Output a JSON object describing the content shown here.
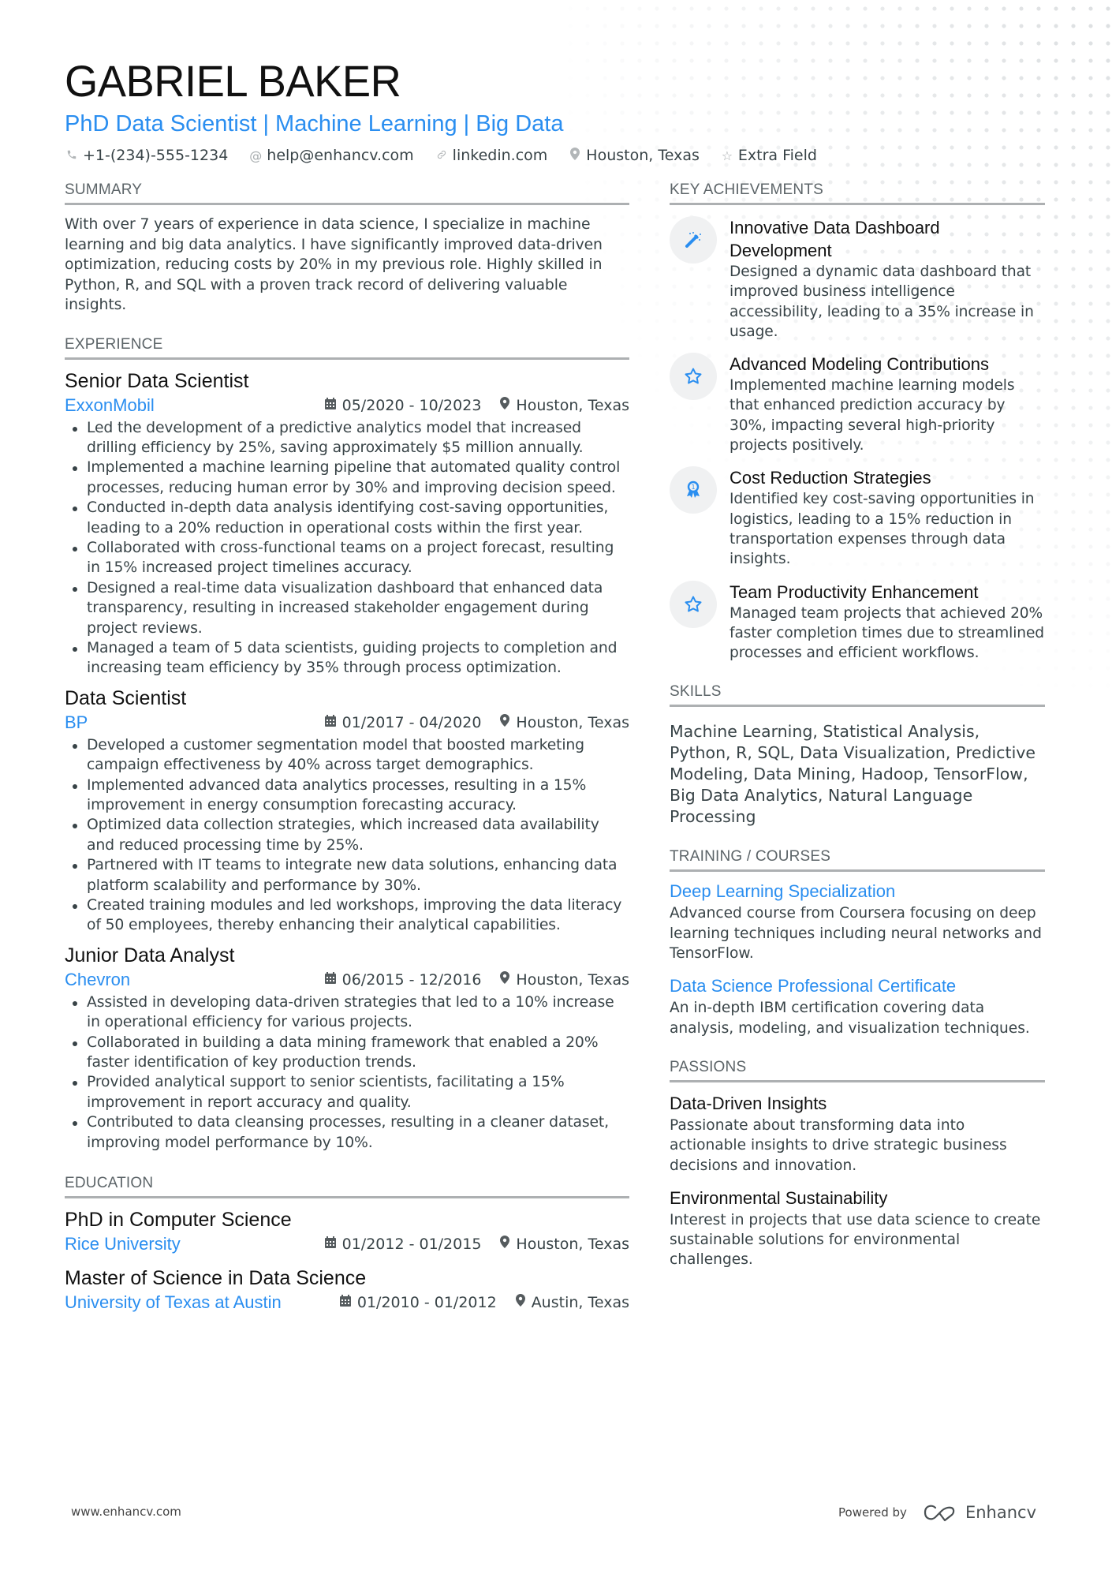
{
  "header": {
    "name": "GABRIEL BAKER",
    "headline": "PhD Data Scientist | Machine Learning | Big Data",
    "contacts": [
      {
        "icon": "phone-icon",
        "text": "+1-(234)-555-1234"
      },
      {
        "icon": "at-icon",
        "text": "help@enhancv.com"
      },
      {
        "icon": "link-icon",
        "text": "linkedin.com"
      },
      {
        "icon": "location-pin-icon",
        "text": "Houston, Texas"
      },
      {
        "icon": "star-outline-icon",
        "text": "Extra Field"
      }
    ]
  },
  "summary": {
    "title": "SUMMARY",
    "text": "With over 7 years of experience in data science, I specialize in machine learning and big data analytics. I have significantly improved data-driven optimization, reducing costs by 20% in my previous role. Highly skilled in Python, R, and SQL with a proven track record of delivering valuable insights."
  },
  "experience": {
    "title": "EXPERIENCE",
    "items": [
      {
        "role": "Senior Data Scientist",
        "company": "ExxonMobil",
        "dates": "05/2020 - 10/2023",
        "location": "Houston, Texas",
        "bullets": [
          "Led the development of a predictive analytics model that increased drilling efficiency by 25%, saving approximately $5 million annually.",
          "Implemented a machine learning pipeline that automated quality control processes, reducing human error by 30% and improving decision speed.",
          "Conducted in-depth data analysis identifying cost-saving opportunities, leading to a 20% reduction in operational costs within the first year.",
          "Collaborated with cross-functional teams on a project forecast, resulting in 15% increased project timelines accuracy.",
          "Designed a real-time data visualization dashboard that enhanced data transparency, resulting in increased stakeholder engagement during project reviews.",
          "Managed a team of 5 data scientists, guiding projects to completion and increasing team efficiency by 35% through process optimization."
        ]
      },
      {
        "role": "Data Scientist",
        "company": "BP",
        "dates": "01/2017 - 04/2020",
        "location": "Houston, Texas",
        "bullets": [
          "Developed a customer segmentation model that boosted marketing campaign effectiveness by 40% across target demographics.",
          "Implemented advanced data analytics processes, resulting in a 15% improvement in energy consumption forecasting accuracy.",
          "Optimized data collection strategies, which increased data availability and reduced processing time by 25%.",
          "Partnered with IT teams to integrate new data solutions, enhancing data platform scalability and performance by 30%.",
          "Created training modules and led workshops, improving the data literacy of 50 employees, thereby enhancing their analytical capabilities."
        ]
      },
      {
        "role": "Junior Data Analyst",
        "company": "Chevron",
        "dates": "06/2015 - 12/2016",
        "location": "Houston, Texas",
        "bullets": [
          "Assisted in developing data-driven strategies that led to a 10% increase in operational efficiency for various projects.",
          "Collaborated in building a data mining framework that enabled a 20% faster identification of key production trends.",
          "Provided analytical support to senior scientists, facilitating a 15% improvement in report accuracy and quality.",
          "Contributed to data cleansing processes, resulting in a cleaner dataset, improving model performance by 10%."
        ]
      }
    ]
  },
  "education": {
    "title": "EDUCATION",
    "items": [
      {
        "degree": "PhD in Computer Science",
        "school": "Rice University",
        "dates": "01/2012 - 01/2015",
        "location": "Houston, Texas"
      },
      {
        "degree": "Master of Science in Data Science",
        "school": "University of Texas at Austin",
        "dates": "01/2010 - 01/2012",
        "location": "Austin, Texas"
      }
    ]
  },
  "achievements": {
    "title": "KEY ACHIEVEMENTS",
    "items": [
      {
        "icon": "magic-wand-icon",
        "title": "Innovative Data Dashboard Development",
        "desc": "Designed a dynamic data dashboard that improved business intelligence accessibility, leading to a 35% increase in usage."
      },
      {
        "icon": "star-icon",
        "title": "Advanced Modeling Contributions",
        "desc": "Implemented machine learning models that enhanced prediction accuracy by 30%, impacting several high-priority projects positively."
      },
      {
        "icon": "award-ribbon-icon",
        "title": "Cost Reduction Strategies",
        "desc": "Identified key cost-saving opportunities in logistics, leading to a 15% reduction in transportation expenses through data insights."
      },
      {
        "icon": "star-icon",
        "title": "Team Productivity Enhancement",
        "desc": "Managed team projects that achieved 20% faster completion times due to streamlined processes and efficient workflows."
      }
    ]
  },
  "skills": {
    "title": "SKILLS",
    "text": "Machine Learning, Statistical Analysis, Python, R, SQL, Data Visualization, Predictive Modeling, Data Mining, Hadoop, TensorFlow, Big Data Analytics, Natural Language Processing"
  },
  "training": {
    "title": "TRAINING / COURSES",
    "items": [
      {
        "title": "Deep Learning Specialization",
        "desc": "Advanced course from Coursera focusing on deep learning techniques including neural networks and TensorFlow."
      },
      {
        "title": "Data Science Professional Certificate",
        "desc": "An in-depth IBM certification covering data analysis, modeling, and visualization techniques."
      }
    ]
  },
  "passions": {
    "title": "PASSIONS",
    "items": [
      {
        "title": "Data-Driven Insights",
        "desc": "Passionate about transforming data into actionable insights to drive strategic business decisions and innovation."
      },
      {
        "title": "Environmental Sustainability",
        "desc": "Interest in projects that use data science to create sustainable solutions for environmental challenges."
      }
    ]
  },
  "footer": {
    "site": "www.enhancv.com",
    "powered_by": "Powered by",
    "brand": "Enhancv"
  },
  "colors": {
    "accent": "#2a8ef0",
    "text": "#384347",
    "heading": "#111111",
    "rule": "#adb0b2"
  }
}
